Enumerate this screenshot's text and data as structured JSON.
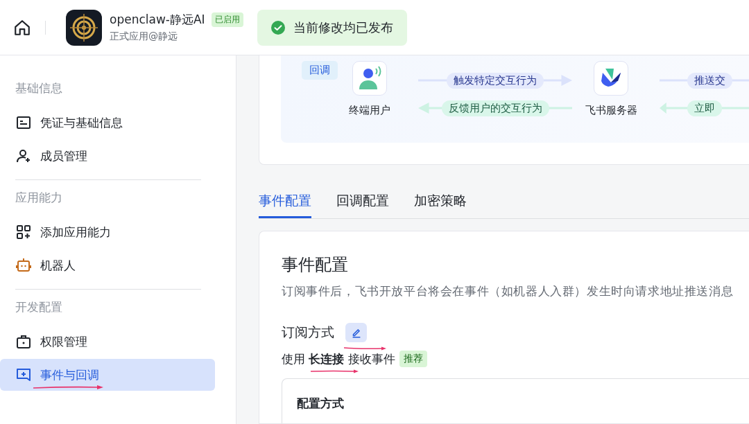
{
  "header": {
    "app_name": "openclaw-静远AI",
    "status_badge": "已启用",
    "subtitle": "正式应用@静远"
  },
  "toast": {
    "message": "当前修改均已发布"
  },
  "sidebar": {
    "groups": [
      {
        "title": "基础信息",
        "items": [
          {
            "label": "凭证与基础信息",
            "selected": false
          },
          {
            "label": "成员管理",
            "selected": false
          }
        ]
      },
      {
        "title": "应用能力",
        "items": [
          {
            "label": "添加应用能力",
            "selected": false
          },
          {
            "label": "机器人",
            "selected": false
          }
        ]
      },
      {
        "title": "开发配置",
        "items": [
          {
            "label": "权限管理",
            "selected": false
          },
          {
            "label": "事件与回调",
            "selected": true
          }
        ]
      }
    ]
  },
  "diagram": {
    "tag": "回调",
    "nodes": [
      {
        "label": "终端用户"
      },
      {
        "label": "飞书服务器"
      }
    ],
    "links": [
      {
        "forward": "触发特定交互行为",
        "back": "反馈用户的交互行为"
      },
      {
        "forward": "推送交",
        "back": "立即"
      }
    ]
  },
  "tabs": [
    {
      "label": "事件配置",
      "selected": true
    },
    {
      "label": "回调配置",
      "selected": false
    },
    {
      "label": "加密策略",
      "selected": false
    }
  ],
  "panel": {
    "title": "事件配置",
    "description": "订阅事件后，飞书开放平台将会在事件（如机器人入群）发生时向请求地址推送消息",
    "subscription_title": "订阅方式",
    "mode_text": "使用 **长连接** 接收事件",
    "mode_badge": "推荐",
    "config_title": "配置方式"
  }
}
